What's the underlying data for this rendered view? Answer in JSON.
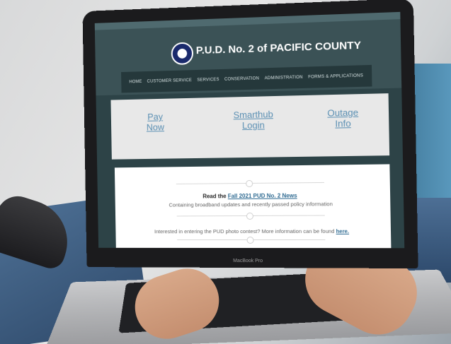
{
  "site": {
    "title": "P.U.D. No. 2 of PACIFIC COUNTY",
    "nav": [
      "HOME",
      "CUSTOMER SERVICE",
      "SERVICES",
      "CONSERVATION",
      "ADMINISTRATION",
      "FORMS & APPLICATIONS"
    ],
    "quick_links": [
      {
        "label": "Pay\nNow"
      },
      {
        "label": "Smarthub\nLogin"
      },
      {
        "label": "Outage\nInfo"
      }
    ],
    "news": {
      "prefix": "Read the ",
      "link": "Fall 2021 PUD No. 2 News",
      "subtitle": "Containing broadband updates and recently passed policy information"
    },
    "photo": {
      "text": "Interested in entering the PUD photo contest? More information can be found ",
      "link": "here."
    }
  },
  "device": {
    "label": "MacBook Pro"
  },
  "colors": {
    "header": "#3b5256",
    "nav": "#25383b",
    "link": "#5a8fb3",
    "accent": "#2f6b92"
  }
}
